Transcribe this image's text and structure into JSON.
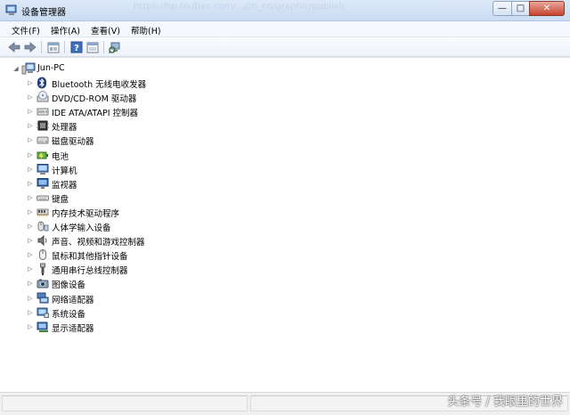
{
  "window": {
    "title": "设备管理器",
    "ghost_url": "https://hp.toutiao.com/.../zh_cn/graphic/publish",
    "minimize_glyph": "—",
    "maximize_glyph": "□",
    "close_glyph": "✕"
  },
  "menu": {
    "file": "文件(F)",
    "action": "操作(A)",
    "view": "查看(V)",
    "help": "帮助(H)"
  },
  "toolbar": {
    "back_icon": "back-arrow-icon",
    "forward_icon": "forward-arrow-icon",
    "properties_icon": "properties-icon",
    "help_icon": "help-icon",
    "view_icon": "view-icon",
    "scan_icon": "scan-hardware-icon"
  },
  "tree": {
    "root": "Jun-PC",
    "items": [
      {
        "label": "Bluetooth 无线电收发器",
        "icon": "bluetooth-icon"
      },
      {
        "label": "DVD/CD-ROM 驱动器",
        "icon": "dvd-drive-icon"
      },
      {
        "label": "IDE ATA/ATAPI 控制器",
        "icon": "ide-controller-icon"
      },
      {
        "label": "处理器",
        "icon": "processor-icon"
      },
      {
        "label": "磁盘驱动器",
        "icon": "disk-drive-icon"
      },
      {
        "label": "电池",
        "icon": "battery-icon"
      },
      {
        "label": "计算机",
        "icon": "computer-icon"
      },
      {
        "label": "监视器",
        "icon": "monitor-icon"
      },
      {
        "label": "键盘",
        "icon": "keyboard-icon"
      },
      {
        "label": "内存技术驱动程序",
        "icon": "memory-icon"
      },
      {
        "label": "人体学输入设备",
        "icon": "hid-icon"
      },
      {
        "label": "声音、视频和游戏控制器",
        "icon": "sound-icon"
      },
      {
        "label": "鼠标和其他指针设备",
        "icon": "mouse-icon"
      },
      {
        "label": "通用串行总线控制器",
        "icon": "usb-icon"
      },
      {
        "label": "图像设备",
        "icon": "imaging-icon"
      },
      {
        "label": "网络适配器",
        "icon": "network-adapter-icon"
      },
      {
        "label": "系统设备",
        "icon": "system-device-icon"
      },
      {
        "label": "显示适配器",
        "icon": "display-adapter-icon"
      }
    ]
  },
  "watermark": "头条号 / 我眼里的世界"
}
